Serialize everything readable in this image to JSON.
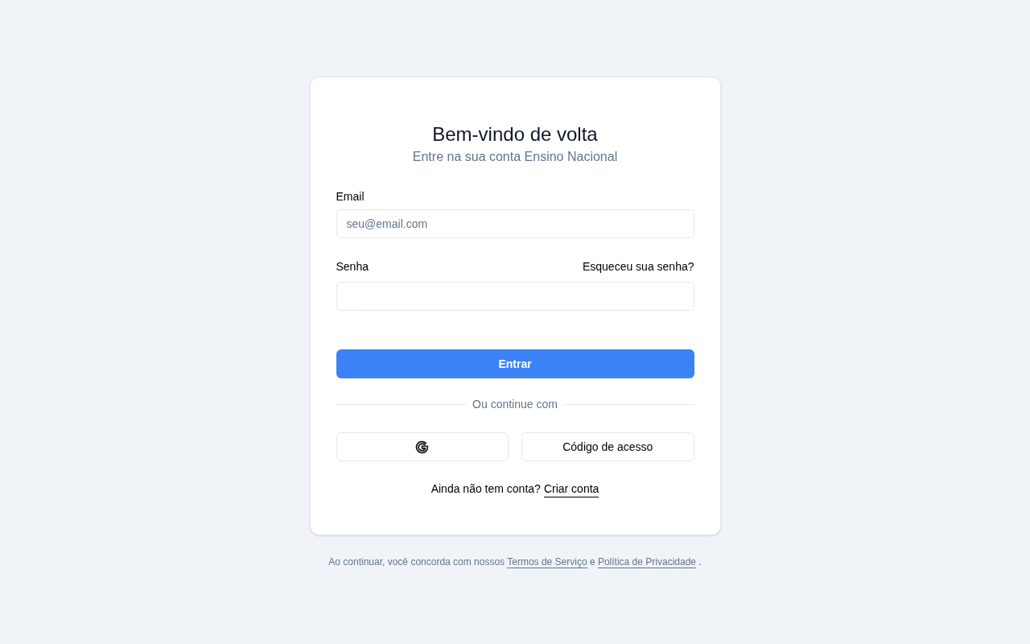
{
  "title": "Bem-vindo de volta",
  "subtitle": "Entre na sua conta Ensino Nacional",
  "email": {
    "label": "Email",
    "placeholder": "seu@email.com"
  },
  "password": {
    "label": "Senha",
    "forgot_link": "Esqueceu sua senha?"
  },
  "submit_button": "Entrar",
  "divider": "Ou continue com",
  "alt_buttons": [
    {
      "kind": "google"
    },
    {
      "kind": "text",
      "label": "Código de acesso"
    }
  ],
  "signup": {
    "text": "Ainda não tem conta?",
    "link": "Criar conta"
  },
  "footer": {
    "text_before": "Ao continuar, você concorda com nossos",
    "terms_link": "Termos de Serviço",
    "text_middle": "e",
    "privacy_link": "Política de Privacidade",
    "text_after": "."
  }
}
